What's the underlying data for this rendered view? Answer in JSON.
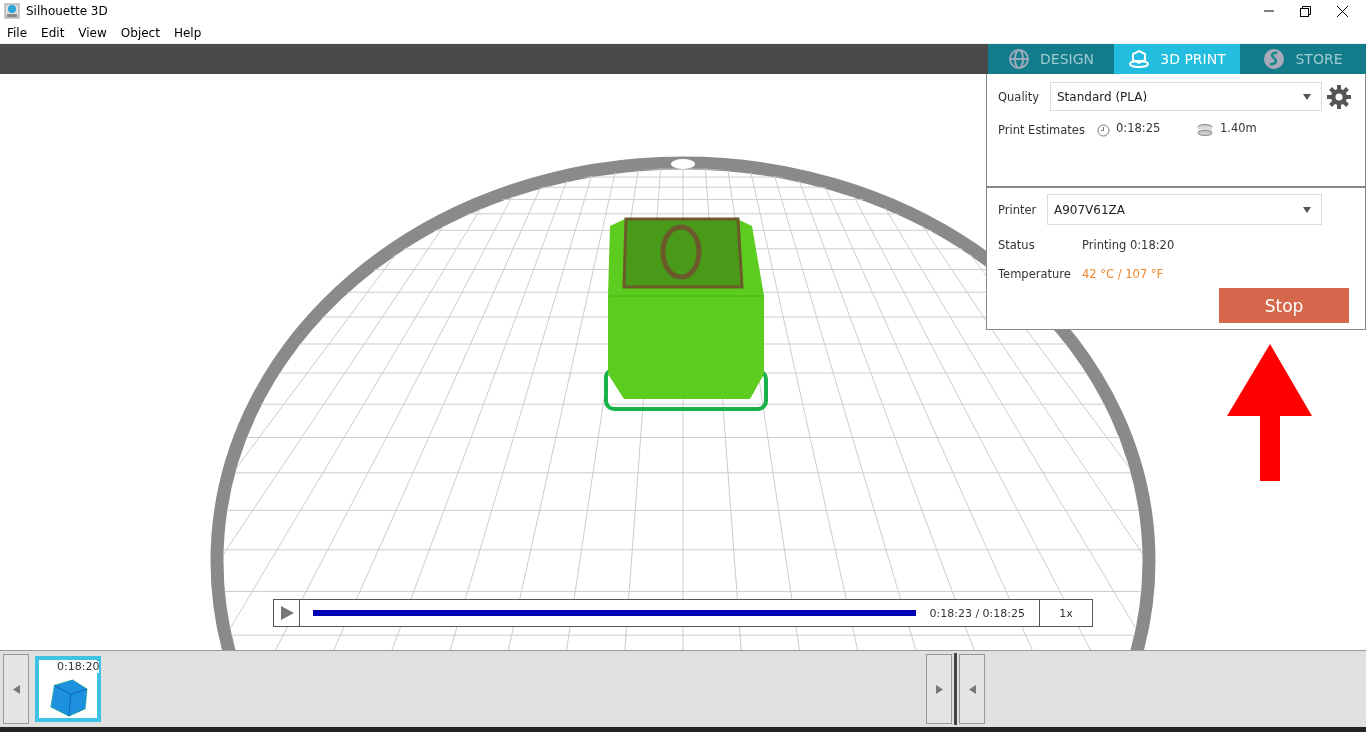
{
  "window": {
    "title": "Silhouette 3D"
  },
  "menu": [
    "File",
    "Edit",
    "View",
    "Object",
    "Help"
  ],
  "tabs": [
    {
      "label": "DESIGN",
      "kind": "globe",
      "selected": false
    },
    {
      "label": "3D PRINT",
      "kind": "print",
      "selected": true
    },
    {
      "label": "STORE",
      "kind": "store",
      "selected": false
    }
  ],
  "settings": {
    "quality_label": "Quality",
    "quality": "Standard (PLA)",
    "estimates_label": "Print Estimates",
    "time": "0:18:25",
    "filament": "1.40m"
  },
  "printer": {
    "label": "Printer",
    "value": "A907V61ZA",
    "status_label": "Status",
    "status": "Printing 0:18:20",
    "temperature_label": "Temperature",
    "temperature": "42 °C / 107 °F",
    "stop": "Stop"
  },
  "playback": {
    "level": 0.998,
    "time": "0:18:23 / 0:18:25",
    "speed": "1x"
  },
  "thumbnails": [
    {
      "label": "0:18:20",
      "selected": true
    }
  ]
}
